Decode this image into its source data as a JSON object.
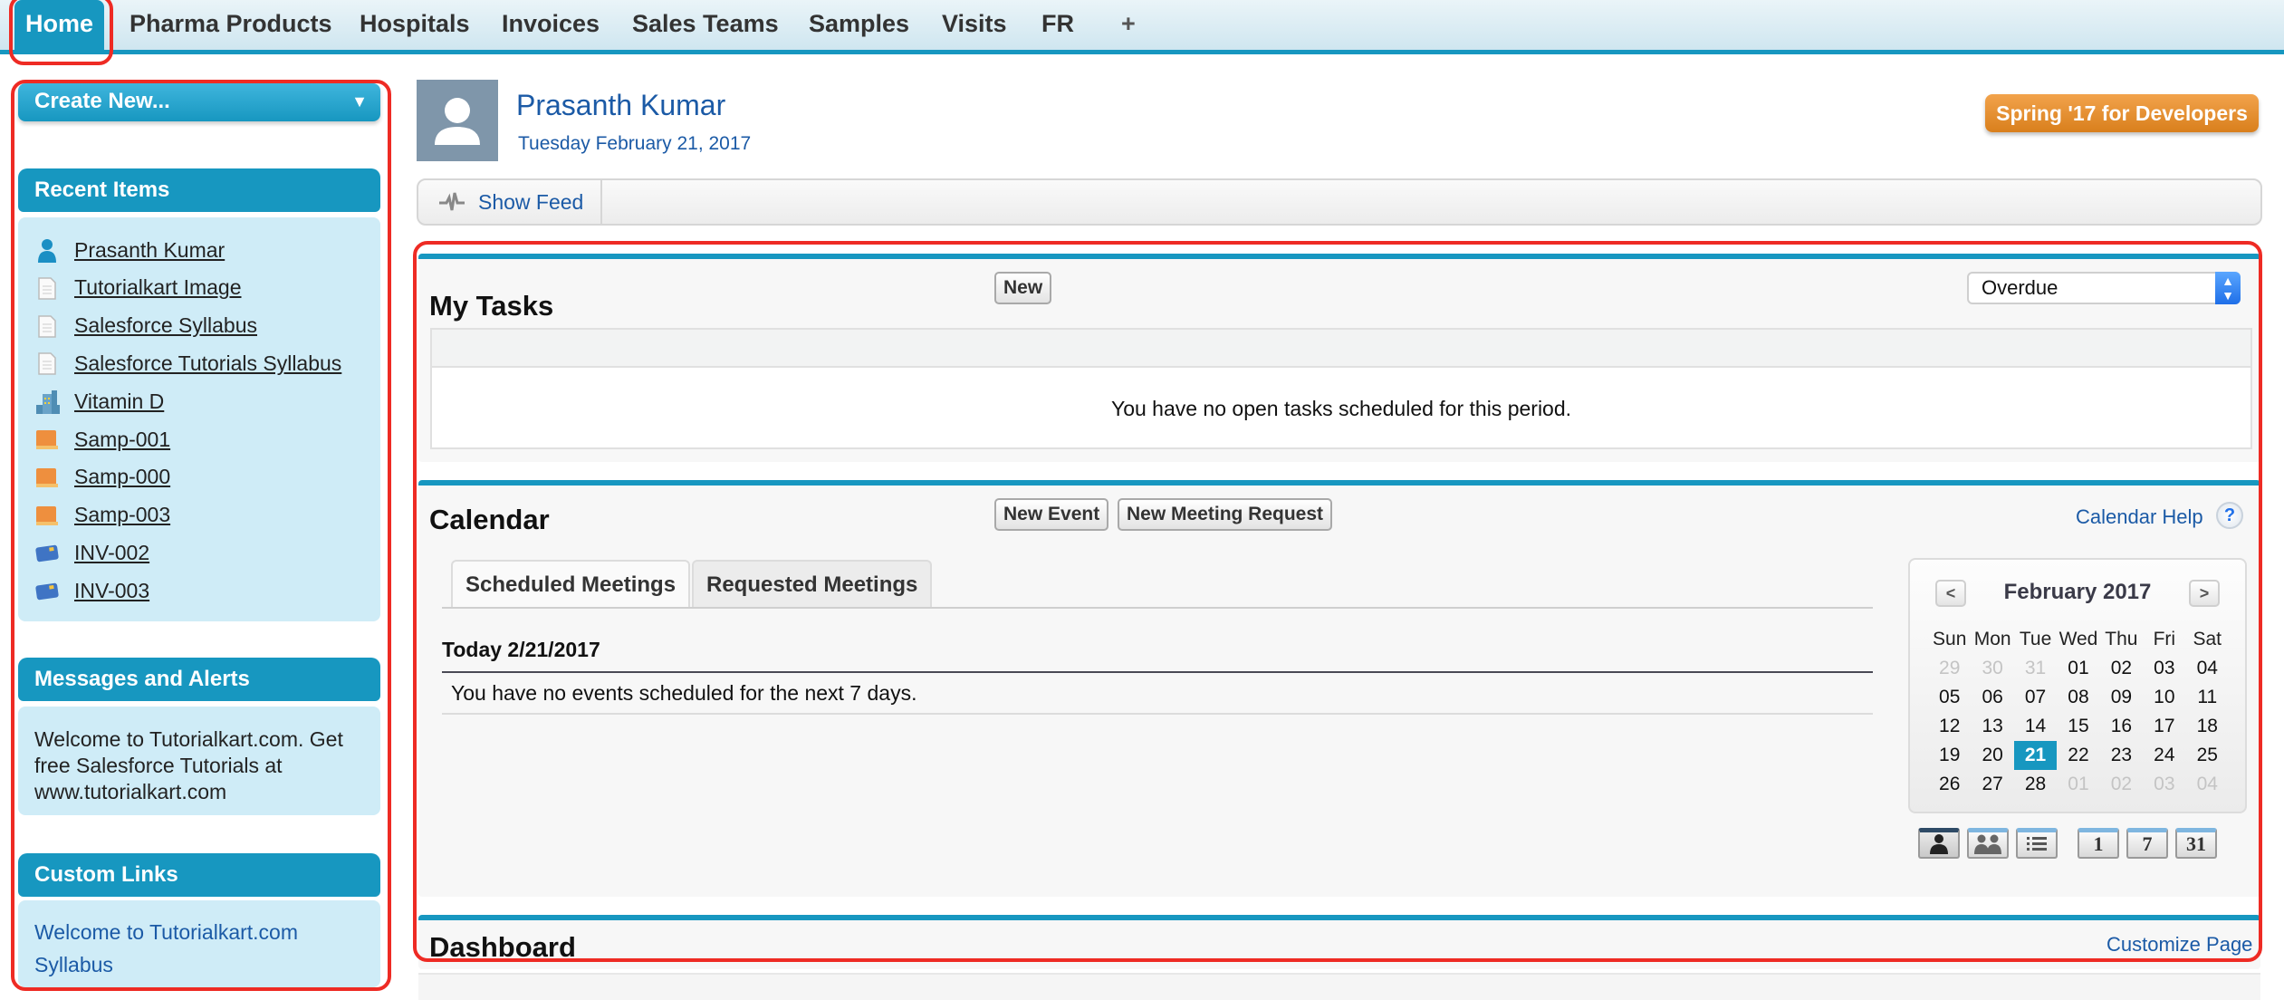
{
  "tabs": [
    {
      "label": "Home",
      "active": true
    },
    {
      "label": "Pharma Products"
    },
    {
      "label": "Hospitals"
    },
    {
      "label": "Invoices"
    },
    {
      "label": "Sales Teams"
    },
    {
      "label": "Samples"
    },
    {
      "label": "Visits"
    },
    {
      "label": "FR"
    },
    {
      "label": "+"
    }
  ],
  "sidebar": {
    "create_new": "Create New...",
    "recent_items": {
      "title": "Recent Items",
      "items": [
        {
          "label": "Prasanth Kumar",
          "icon": "user-icon"
        },
        {
          "label": "Tutorialkart Image",
          "icon": "document-icon"
        },
        {
          "label": "Salesforce Syllabus",
          "icon": "document-icon"
        },
        {
          "label": "Salesforce Tutorials Syllabus",
          "icon": "document-icon"
        },
        {
          "label": "Vitamin D",
          "icon": "building-icon"
        },
        {
          "label": "Samp-001",
          "icon": "sample-icon"
        },
        {
          "label": "Samp-000",
          "icon": "sample-icon"
        },
        {
          "label": "Samp-003",
          "icon": "sample-icon"
        },
        {
          "label": "INV-002",
          "icon": "invoice-card-icon"
        },
        {
          "label": "INV-003",
          "icon": "invoice-card-icon"
        }
      ]
    },
    "messages": {
      "title": "Messages and Alerts",
      "text": "Welcome to Tutorialkart.com. Get free Salesforce Tutorials at www.tutorialkart.com"
    },
    "custom_links": {
      "title": "Custom Links",
      "links": [
        "Welcome to Tutorialkart.com",
        "Syllabus"
      ]
    }
  },
  "header": {
    "user_name": "Prasanth Kumar",
    "date": "Tuesday February 21, 2017",
    "release_button": "Spring '17 for Developers",
    "show_feed": "Show Feed"
  },
  "tasks": {
    "title": "My Tasks",
    "new_button": "New",
    "filter_value": "Overdue",
    "empty_message": "You have no open tasks scheduled for this period."
  },
  "calendar": {
    "title": "Calendar",
    "new_event": "New Event",
    "new_meeting_request": "New Meeting Request",
    "help_link": "Calendar Help",
    "help_icon": "?",
    "tabs": [
      "Scheduled Meetings",
      "Requested Meetings"
    ],
    "today_label": "Today 2/21/2017",
    "empty_message": "You have no events scheduled for the next 7 days.",
    "mini": {
      "prev": "<",
      "next": ">",
      "month": "February 2017",
      "weekdays": [
        "Sun",
        "Mon",
        "Tue",
        "Wed",
        "Thu",
        "Fri",
        "Sat"
      ],
      "weeks": [
        [
          [
            "29",
            1
          ],
          [
            "30",
            1
          ],
          [
            "31",
            1
          ],
          [
            "01",
            0
          ],
          [
            "02",
            0
          ],
          [
            "03",
            0
          ],
          [
            "04",
            0
          ]
        ],
        [
          [
            "05",
            0
          ],
          [
            "06",
            0
          ],
          [
            "07",
            0
          ],
          [
            "08",
            0
          ],
          [
            "09",
            0
          ],
          [
            "10",
            0
          ],
          [
            "11",
            0
          ]
        ],
        [
          [
            "12",
            0
          ],
          [
            "13",
            0
          ],
          [
            "14",
            0
          ],
          [
            "15",
            0
          ],
          [
            "16",
            0
          ],
          [
            "17",
            0
          ],
          [
            "18",
            0
          ]
        ],
        [
          [
            "19",
            0
          ],
          [
            "20",
            0
          ],
          [
            "21",
            2
          ],
          [
            "22",
            0
          ],
          [
            "23",
            0
          ],
          [
            "24",
            0
          ],
          [
            "25",
            0
          ]
        ],
        [
          [
            "26",
            0
          ],
          [
            "27",
            0
          ],
          [
            "28",
            0
          ],
          [
            "01",
            1
          ],
          [
            "02",
            1
          ],
          [
            "03",
            1
          ],
          [
            "04",
            1
          ]
        ]
      ],
      "today": "21"
    },
    "view_buttons": [
      {
        "name": "single-user-view",
        "label": ""
      },
      {
        "name": "multi-user-view",
        "label": ""
      },
      {
        "name": "list-view",
        "label": ""
      },
      {
        "name": "day-view",
        "label": "1"
      },
      {
        "name": "week-view",
        "label": "7"
      },
      {
        "name": "month-view",
        "label": "31"
      }
    ]
  },
  "dashboard": {
    "title": "Dashboard",
    "customize_link": "Customize Page"
  },
  "colors": {
    "brand_blue": "#1797c0",
    "sidebar_bg": "#cfecf7",
    "link_blue": "#1b5aa6",
    "release_orange": "#e58e2a",
    "highlight_red": "#ee2b24"
  }
}
